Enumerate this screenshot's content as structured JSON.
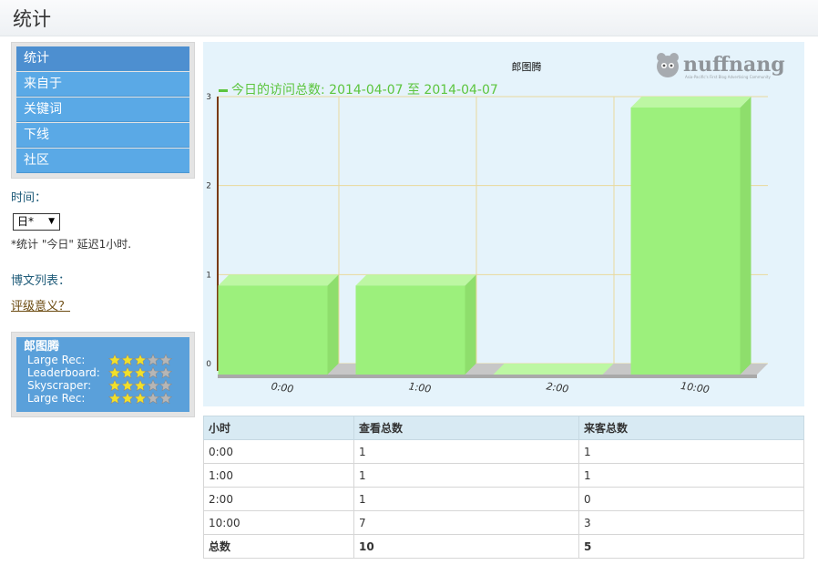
{
  "page": {
    "title": "统计"
  },
  "sidebar": {
    "nav": [
      {
        "label": "统计",
        "active": true
      },
      {
        "label": "来自于",
        "active": false
      },
      {
        "label": "关键词",
        "active": false
      },
      {
        "label": "下线",
        "active": false
      },
      {
        "label": "社区",
        "active": false
      }
    ],
    "time_label": "时间：",
    "period_select": {
      "selected": "日*"
    },
    "delay_note": "*统计 \"今日\" 延迟1小时.",
    "post_list_label": "博文列表：",
    "rating_link": "评级意义？"
  },
  "ratings": {
    "name": "郎图腾",
    "rows": [
      {
        "label": "Large Rec:",
        "stars": 3,
        "max": 5
      },
      {
        "label": "Leaderboard:",
        "stars": 3,
        "max": 5
      },
      {
        "label": "Skyscraper:",
        "stars": 3,
        "max": 5
      },
      {
        "label": "Large Rec:",
        "stars": 3,
        "max": 5
      }
    ]
  },
  "logo": {
    "text": "nuffnang",
    "tagline": "Asia-Pacific's First Blog Advertising Community"
  },
  "colors": {
    "bar": "#9cf07c",
    "legend": "#5cc53e",
    "nav": "#5aa9e6",
    "nav_active": "#4d8fd0",
    "star_filled": "#f1e02a",
    "star_empty": "#b6b6b6"
  },
  "chart_data": {
    "type": "bar",
    "title": "郎图腾",
    "legend": "今日的访问总数: 2014-04-07 至 2014-04-07",
    "categories": [
      "0:00",
      "1:00",
      "2:00",
      "10:00"
    ],
    "series": [
      {
        "name": "今日的访问总数: 2014-04-07 至 2014-04-07",
        "values": [
          1,
          1,
          0,
          3
        ]
      }
    ],
    "y_ticks": [
      "0",
      "1",
      "2",
      "3"
    ],
    "ylim": [
      0,
      3
    ],
    "grid": true,
    "legend_position": "top-left",
    "xlabel": "",
    "ylabel": ""
  },
  "table": {
    "headers": [
      "小时",
      "查看总数",
      "来客总数"
    ],
    "rows": [
      [
        "0:00",
        "1",
        "1"
      ],
      [
        "1:00",
        "1",
        "1"
      ],
      [
        "2:00",
        "1",
        "0"
      ],
      [
        "10:00",
        "7",
        "3"
      ]
    ],
    "total": [
      "总数",
      "10",
      "5"
    ]
  }
}
